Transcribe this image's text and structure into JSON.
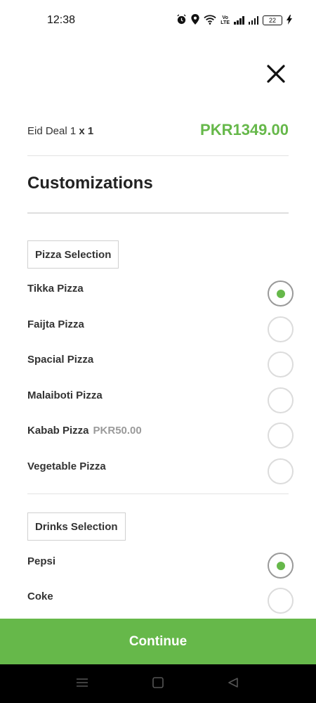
{
  "status_bar": {
    "time": "12:38",
    "volte_top": "Vo",
    "volte_bottom": "LTE",
    "battery": "22"
  },
  "item": {
    "name": "Eid Deal 1",
    "quantity": "x 1",
    "price": "PKR1349.00"
  },
  "heading": "Customizations",
  "groups": [
    {
      "label": "Pizza Selection",
      "options": [
        {
          "label": "Tikka Pizza",
          "extra": "",
          "selected": true
        },
        {
          "label": "Faijta Pizza",
          "extra": "",
          "selected": false
        },
        {
          "label": "Spacial Pizza",
          "extra": "",
          "selected": false
        },
        {
          "label": "Malaiboti Pizza",
          "extra": "",
          "selected": false
        },
        {
          "label": "Kabab Pizza",
          "extra": "PKR50.00",
          "selected": false
        },
        {
          "label": "Vegetable Pizza",
          "extra": "",
          "selected": false
        }
      ]
    },
    {
      "label": "Drinks Selection",
      "options": [
        {
          "label": "Pepsi",
          "extra": "",
          "selected": true
        },
        {
          "label": "Coke",
          "extra": "",
          "selected": false
        }
      ]
    }
  ],
  "continue_label": "Continue",
  "colors": {
    "accent": "#66b84a",
    "nav_bg": "#000000"
  },
  "icons": {
    "close": "close-icon",
    "nav_menu": "menu-icon",
    "nav_home": "home-icon",
    "nav_back": "back-icon"
  }
}
